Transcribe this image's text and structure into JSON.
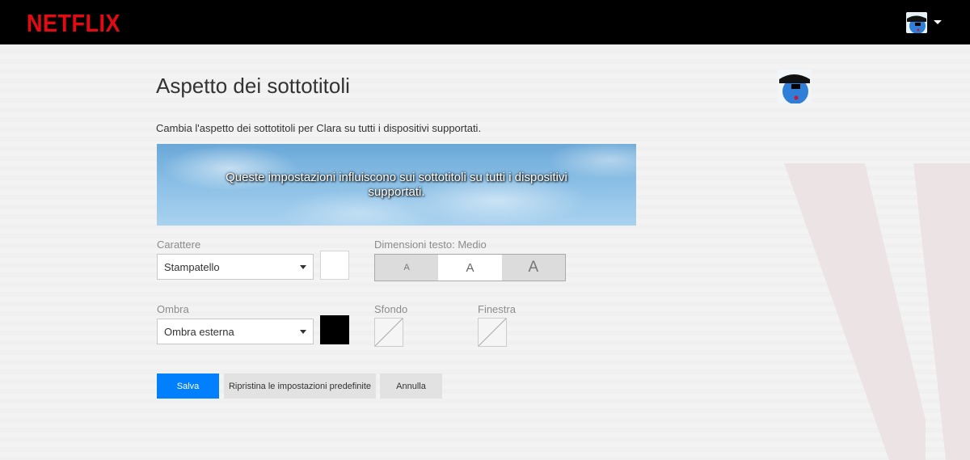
{
  "header": {
    "logo_text": "NETFLIX",
    "brand_color": "#e50914",
    "profile_icon": "profile-avatar-icon",
    "menu_icon": "caret-down-icon"
  },
  "page": {
    "title": "Aspetto dei sottotitoli",
    "subtitle": "Cambia l'aspetto dei sottotitoli per Clara su tutti i dispositivi supportati.",
    "preview_text": "Queste impostazioni influiscono sui sottotitoli su tutti i dispositivi supportati."
  },
  "settings": {
    "font": {
      "label": "Carattere",
      "selected": "Stampatello",
      "color": "#ffffff"
    },
    "text_size": {
      "label": "Dimensioni testo: Medio",
      "options": [
        "A",
        "A",
        "A"
      ],
      "selected_index": 1
    },
    "shadow": {
      "label": "Ombra",
      "selected": "Ombra esterna",
      "color": "#000000"
    },
    "background": {
      "label": "Sfondo",
      "value": "none"
    },
    "window": {
      "label": "Finestra",
      "value": "none"
    }
  },
  "actions": {
    "save": "Salva",
    "reset": "Ripristina le impostazioni predefinite",
    "cancel": "Annulla",
    "primary_color": "#0080ff"
  }
}
